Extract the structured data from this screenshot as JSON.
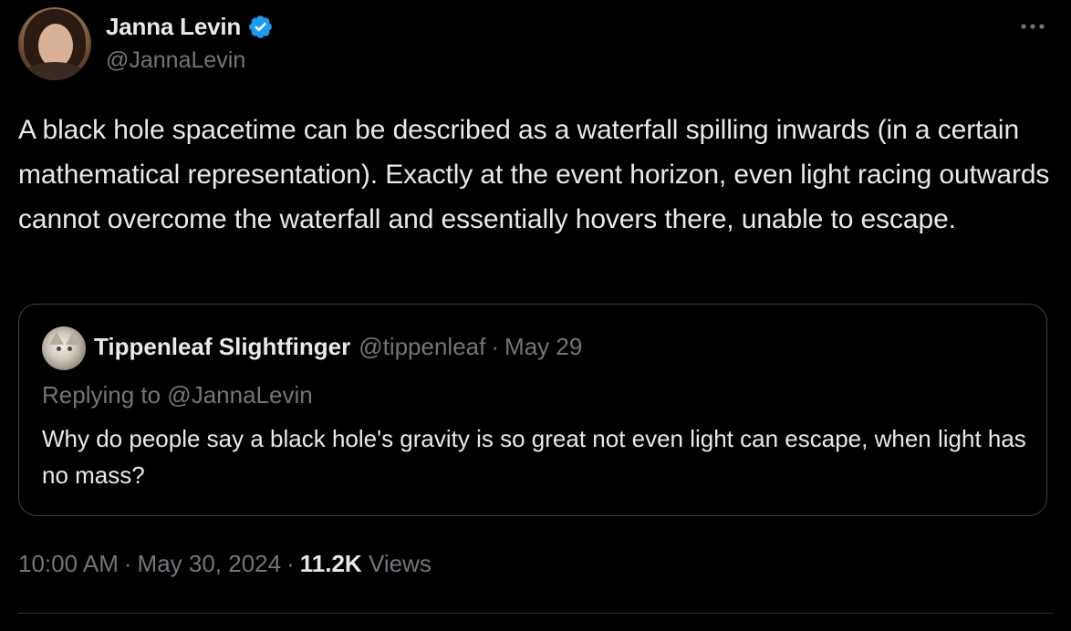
{
  "author": {
    "display_name": "Janna Levin",
    "handle": "@JannaLevin",
    "verified": true,
    "avatar_icon": "profile-photo"
  },
  "tweet": {
    "text": "A black hole spacetime can be described as a waterfall spilling inwards (in a certain mathematical representation). Exactly at the event horizon, even light racing outwards cannot overcome the waterfall and essentially hovers there, unable to escape."
  },
  "quoted": {
    "display_name": "Tippenleaf Slightfinger",
    "handle": "@tippenleaf",
    "separator": "·",
    "date": "May 29",
    "replying_to": "Replying to @JannaLevin",
    "text": "Why do people say a black hole's gravity is so great not even light can escape, when light has no mass?"
  },
  "meta": {
    "time": "10:00 AM",
    "separator": "·",
    "date": "May 30, 2024",
    "views_count": "11.2K",
    "views_label": "Views"
  },
  "colors": {
    "background": "#000000",
    "text_primary": "#e7e9ea",
    "text_secondary": "#71767b",
    "verified_blue": "#1d9bf0",
    "border": "#3e4144"
  },
  "icons": {
    "verified": "verified-badge-icon",
    "more": "more-options-icon"
  }
}
